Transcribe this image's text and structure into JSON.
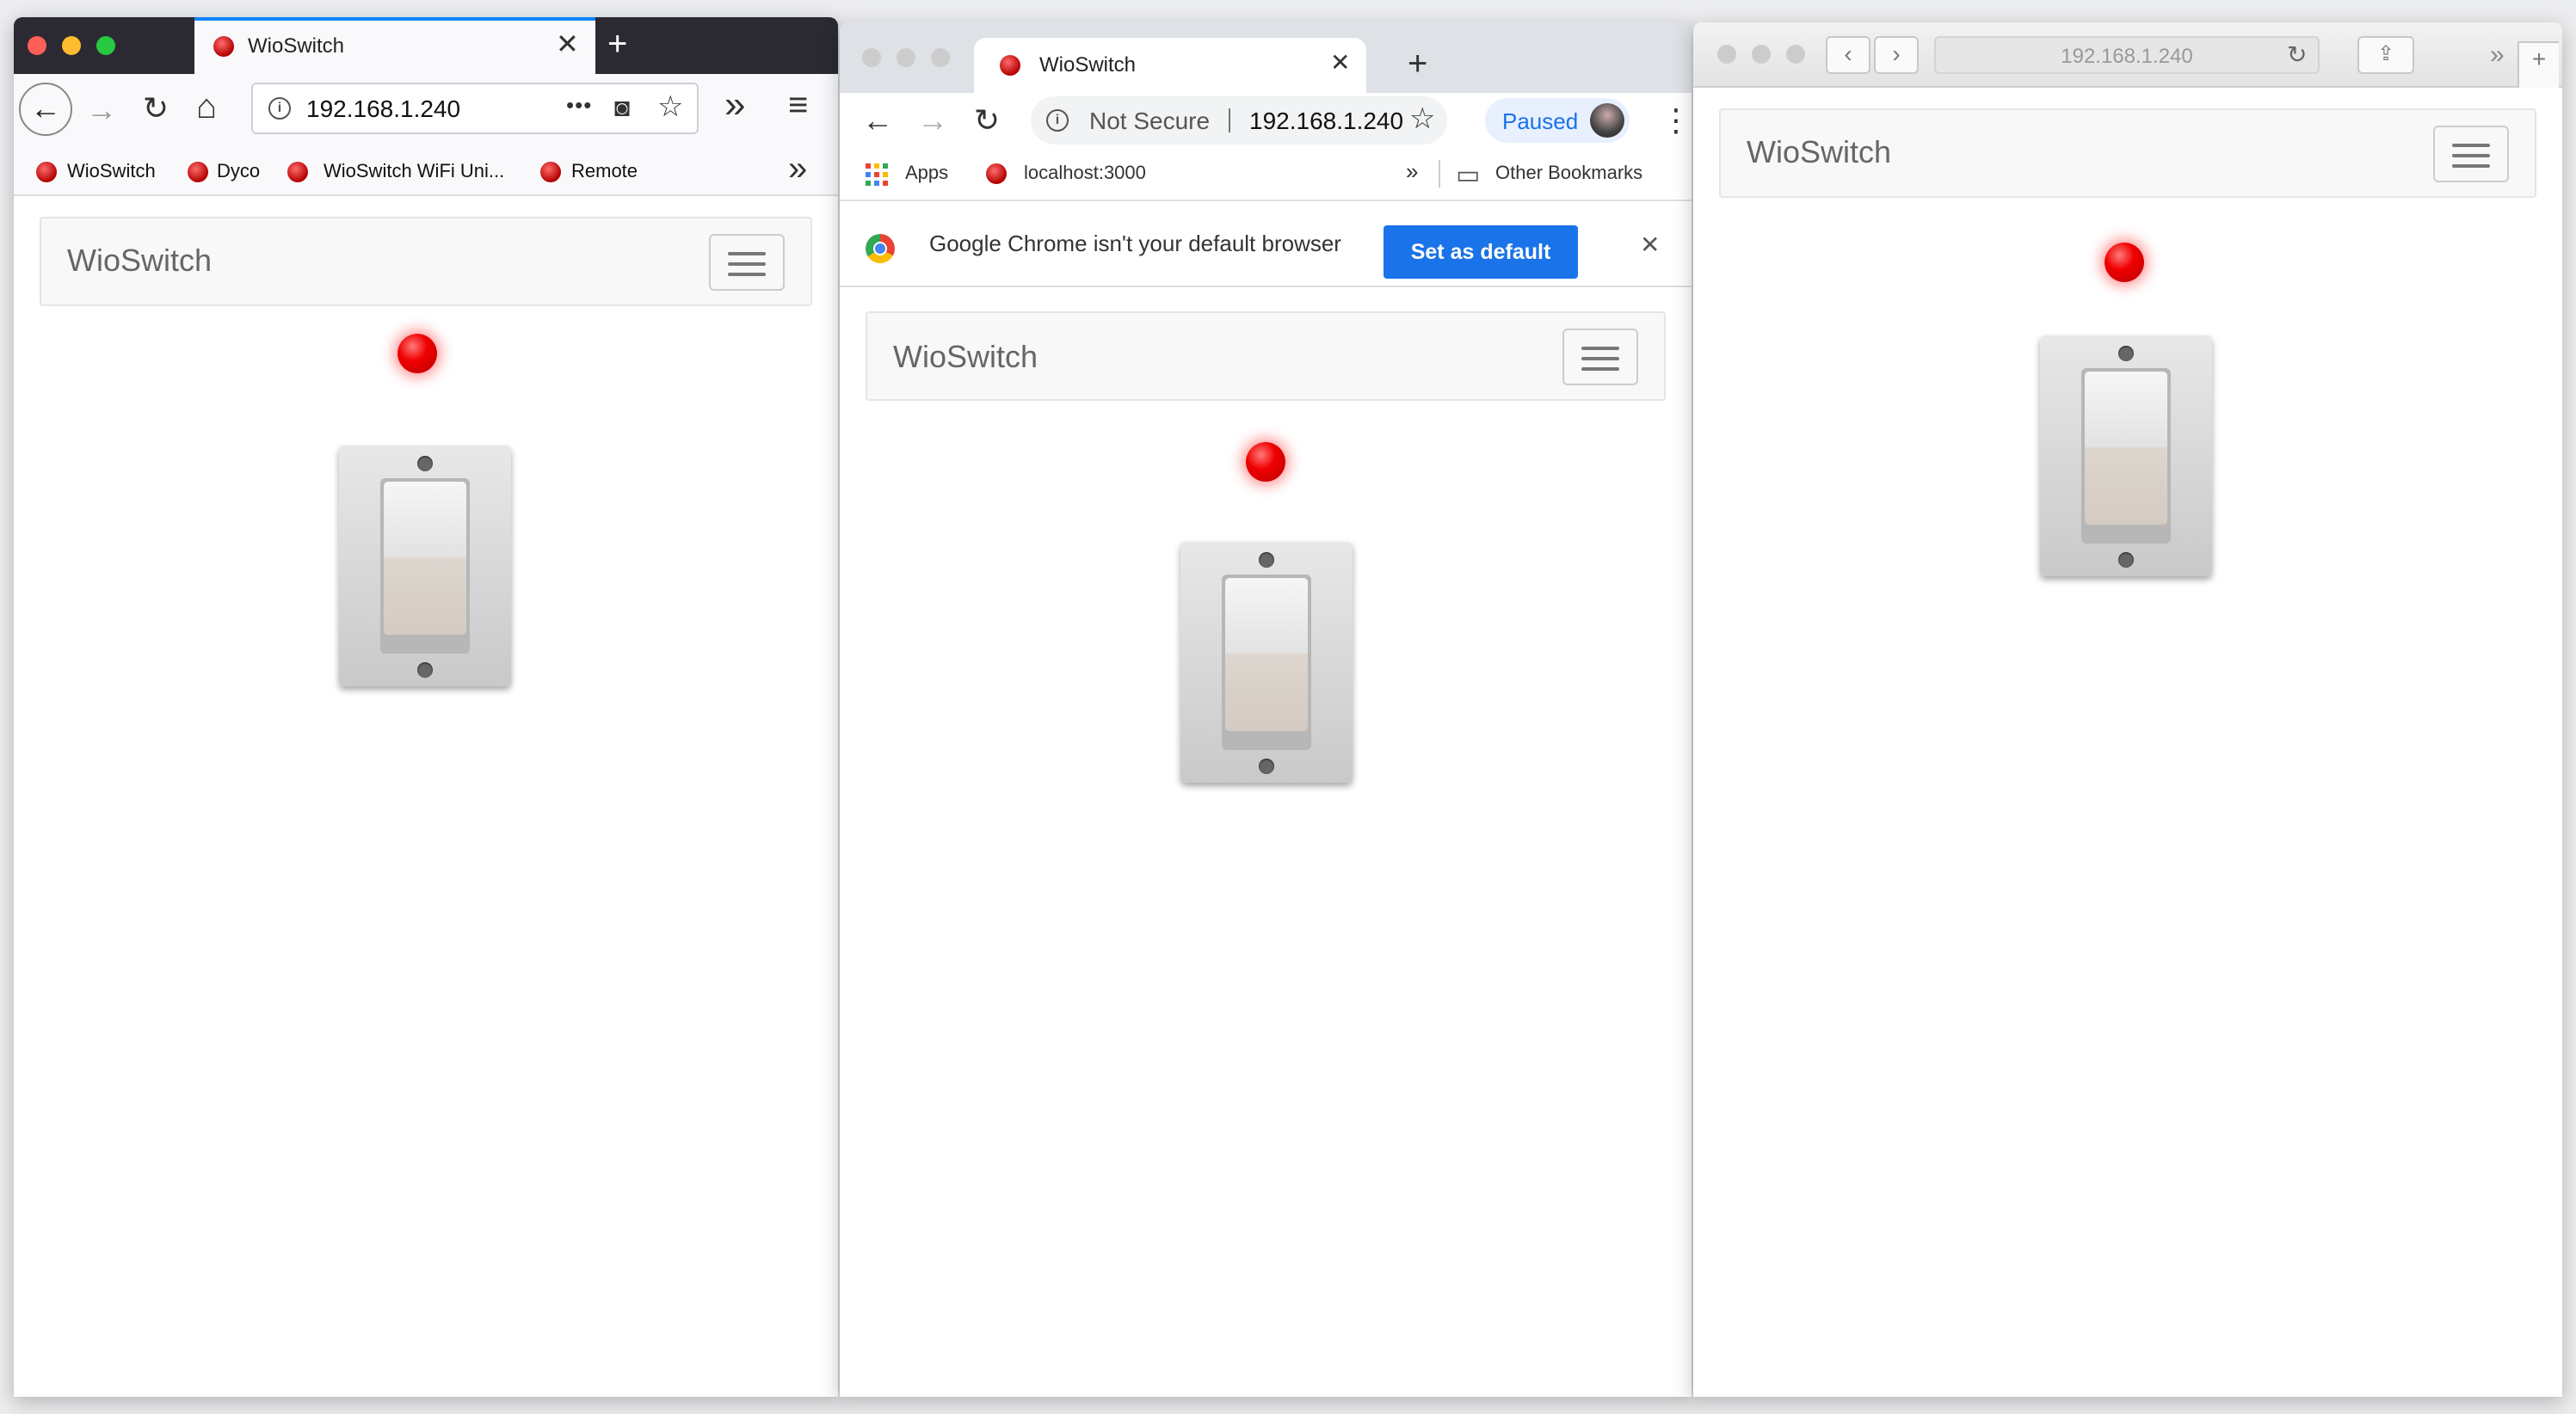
{
  "firefox": {
    "tab_title": "WioSwitch",
    "url": "192.168.1.240",
    "bookmarks": [
      "WioSwitch",
      "Dyco",
      "WioSwitch WiFi Uni...",
      "Remote"
    ]
  },
  "chrome": {
    "tab_title": "WioSwitch",
    "security_label": "Not Secure",
    "url": "192.168.1.240",
    "profile_status": "Paused",
    "bookmarks": {
      "apps": "Apps",
      "localhost": "localhost:3000",
      "other": "Other Bookmarks"
    },
    "infobar": {
      "message": "Google Chrome isn't your default browser",
      "button": "Set as default"
    }
  },
  "safari": {
    "url": "192.168.1.240"
  },
  "app": {
    "brand": "WioSwitch",
    "led_state": "on",
    "switch_state": "up"
  },
  "colors": {
    "led_red": "#ff0000",
    "chrome_blue": "#1a73e8",
    "firefox_accent": "#0a84ff"
  },
  "icons": {
    "back": "←",
    "forward": "→",
    "reload": "↻",
    "home": "⌂",
    "more": "•••",
    "star": "☆",
    "close": "✕",
    "plus": "+",
    "chevrons": "»",
    "hamburger": "≡",
    "kebab": "⋮"
  }
}
